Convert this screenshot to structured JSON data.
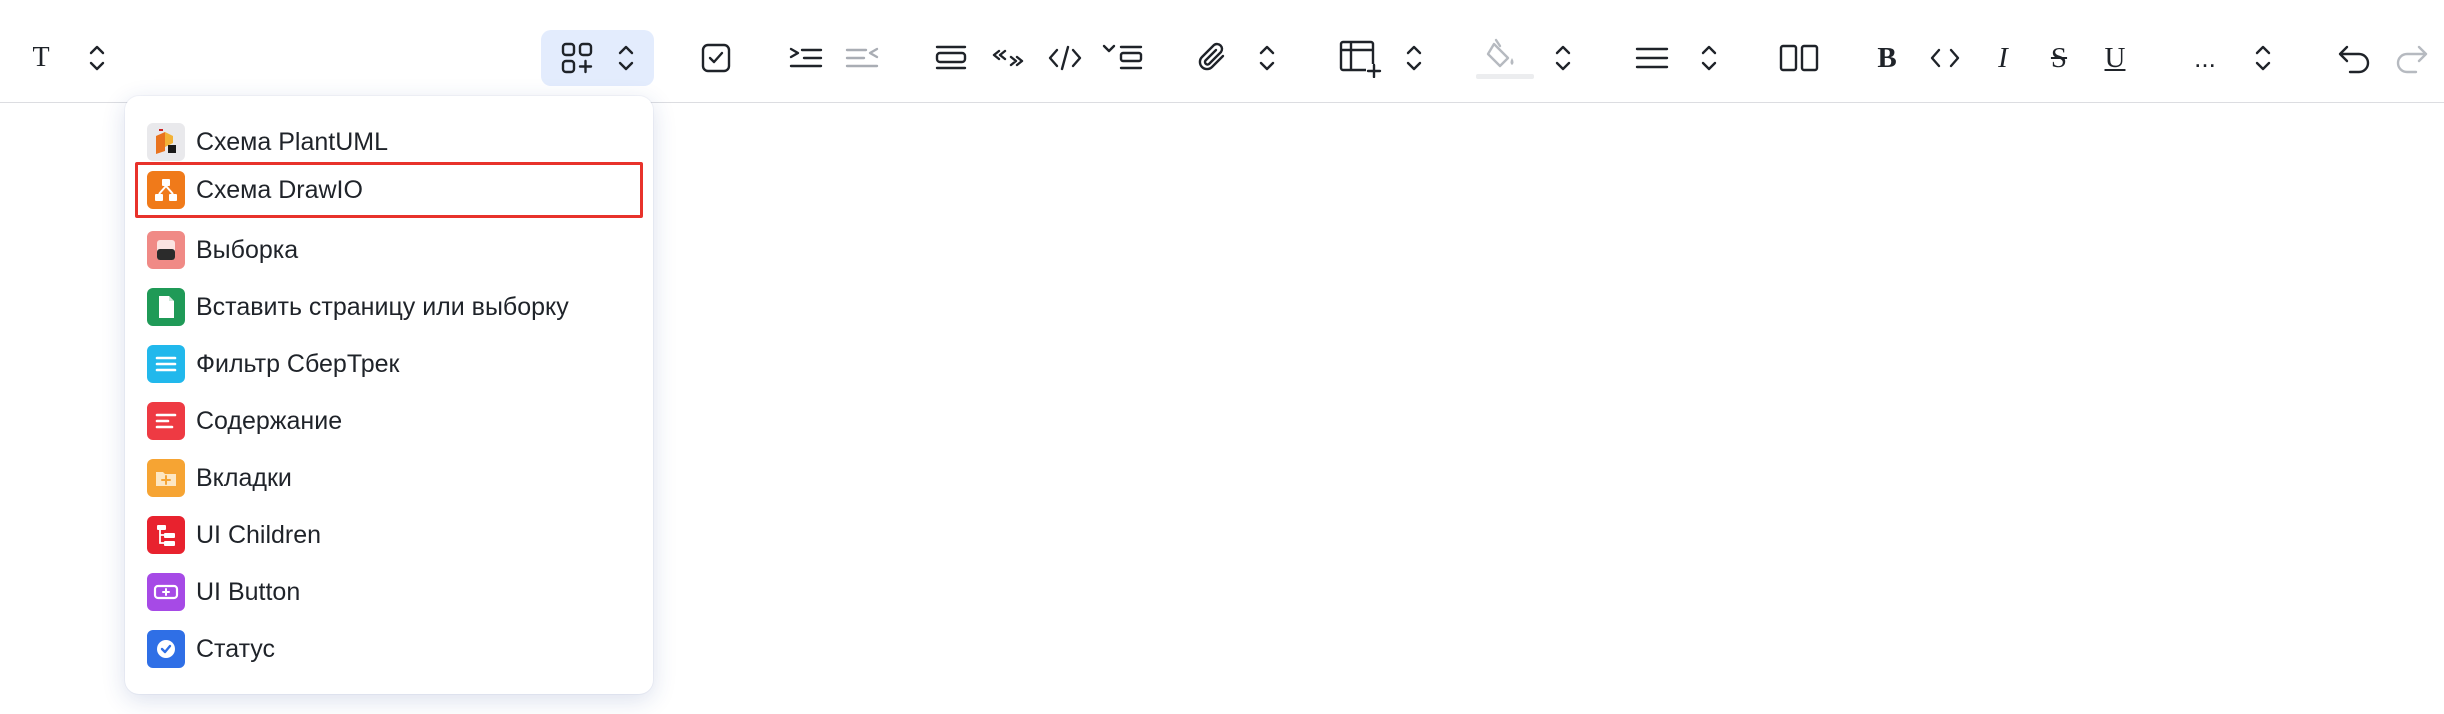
{
  "toolbar": {
    "text_style": "T",
    "bold": "B",
    "italic": "I",
    "strike": "S",
    "underline": "U",
    "more": "..."
  },
  "insert_menu": {
    "items": [
      {
        "label": "Схема PlantUML",
        "icon": "plantuml-icon",
        "color": "#e9e9ec"
      },
      {
        "label": "Схема DrawIO",
        "icon": "drawio-icon",
        "color": "#f07a1a",
        "selected": true
      },
      {
        "label": "Выборка",
        "icon": "selection-icon",
        "color": "#f08a86"
      },
      {
        "label": "Вставить страницу или выборку",
        "icon": "page-icon",
        "color": "#1f9a57"
      },
      {
        "label": "Фильтр СберТрек",
        "icon": "filter-icon",
        "color": "#21b8ec"
      },
      {
        "label": "Содержание",
        "icon": "contents-icon",
        "color": "#ee3a43"
      },
      {
        "label": "Вкладки",
        "icon": "folder-icon",
        "color": "#f6a433"
      },
      {
        "label": "UI Children",
        "icon": "children-icon",
        "color": "#e8222e"
      },
      {
        "label": "UI Button",
        "icon": "button-icon",
        "color": "#a64ae6"
      },
      {
        "label": "Статус",
        "icon": "status-icon",
        "color": "#2f6fe6"
      }
    ]
  },
  "colors": {
    "active_bg": "#e3ecfd",
    "highlight_border": "#e8322b",
    "divider": "#dcdde1"
  }
}
